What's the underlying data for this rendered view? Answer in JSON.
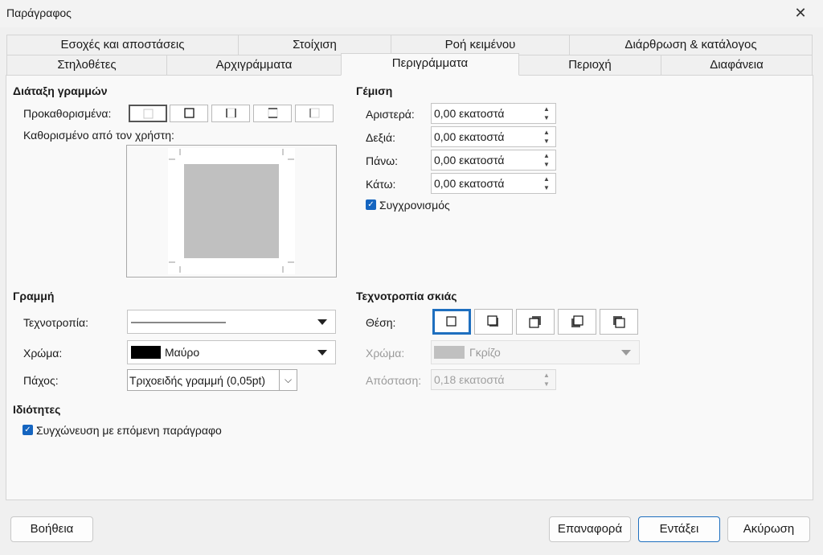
{
  "window": {
    "title": "Παράγραφος"
  },
  "tabs_row1": [
    {
      "label": "Εσοχές και αποστάσεις"
    },
    {
      "label": "Στοίχιση"
    },
    {
      "label": "Ροή κειμένου"
    },
    {
      "label": "Διάρθρωση & κατάλογος"
    }
  ],
  "tabs_row2": [
    {
      "label": "Στηλοθέτες"
    },
    {
      "label": "Αρχιγράμματα"
    },
    {
      "label": "Περιγράμματα",
      "active": true
    },
    {
      "label": "Περιοχή"
    },
    {
      "label": "Διαφάνεια"
    }
  ],
  "line_arrangement": {
    "title": "Διάταξη γραμμών",
    "presets_label": "Προκαθορισμένα:",
    "user_defined_label": "Καθορισμένο από τον χρήστη:"
  },
  "padding": {
    "title": "Γέμιση",
    "fields": [
      {
        "label": "Αριστερά:",
        "value": "0,00 εκατοστά"
      },
      {
        "label": "Δεξιά:",
        "value": "0,00 εκατοστά"
      },
      {
        "label": "Πάνω:",
        "value": "0,00 εκατοστά"
      },
      {
        "label": "Κάτω:",
        "value": "0,00 εκατοστά"
      }
    ],
    "sync_label": "Συγχρονισμός",
    "sync_checked": true
  },
  "line": {
    "title": "Γραμμή",
    "style_label": "Τεχνοτροπία:",
    "color_label": "Χρώμα:",
    "color_value": "Μαύρο",
    "color_swatch": "#000000",
    "width_label": "Πάχος:",
    "width_value": "Τριχοειδής γραμμή (0,05pt)"
  },
  "properties": {
    "title": "Ιδιότητες",
    "merge_label": "Συγχώνευση με επόμενη παράγραφο",
    "merge_checked": true
  },
  "shadow": {
    "title": "Τεχνοτροπία σκιάς",
    "position_label": "Θέση:",
    "color_label": "Χρώμα:",
    "color_value": "Γκρίζο",
    "color_swatch": "#c0c0c0",
    "distance_label": "Απόσταση:",
    "distance_value": "0,18 εκατοστά"
  },
  "buttons": {
    "help": "Βοήθεια",
    "reset": "Επαναφορά",
    "ok": "Εντάξει",
    "cancel": "Ακύρωση"
  },
  "colors": {
    "accent": "#1e6fbf",
    "checkbox": "#1565c0",
    "preview_fill": "#c0c0c0"
  }
}
